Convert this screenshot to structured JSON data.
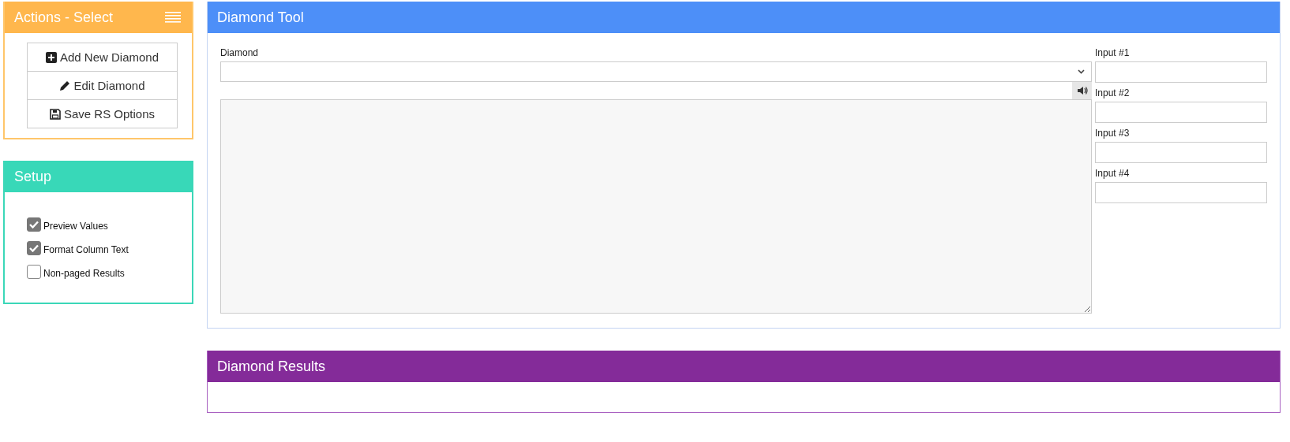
{
  "actions": {
    "title": "Actions - Select",
    "buttons": [
      {
        "label": "Add New Diamond",
        "kind": "add"
      },
      {
        "label": "Edit Diamond",
        "kind": "edit"
      },
      {
        "label": "Save RS Options",
        "kind": "save"
      }
    ]
  },
  "setup": {
    "title": "Setup",
    "options": [
      {
        "label": "Preview Values",
        "checked": true
      },
      {
        "label": "Format Column Text",
        "checked": true
      },
      {
        "label": "Non-paged Results",
        "checked": false
      }
    ]
  },
  "tool": {
    "title": "Diamond Tool",
    "select_label": "Diamond",
    "inputs": [
      {
        "label": "Input #1"
      },
      {
        "label": "Input #2"
      },
      {
        "label": "Input #3"
      },
      {
        "label": "Input #4"
      }
    ]
  },
  "results": {
    "title": "Diamond Results"
  }
}
